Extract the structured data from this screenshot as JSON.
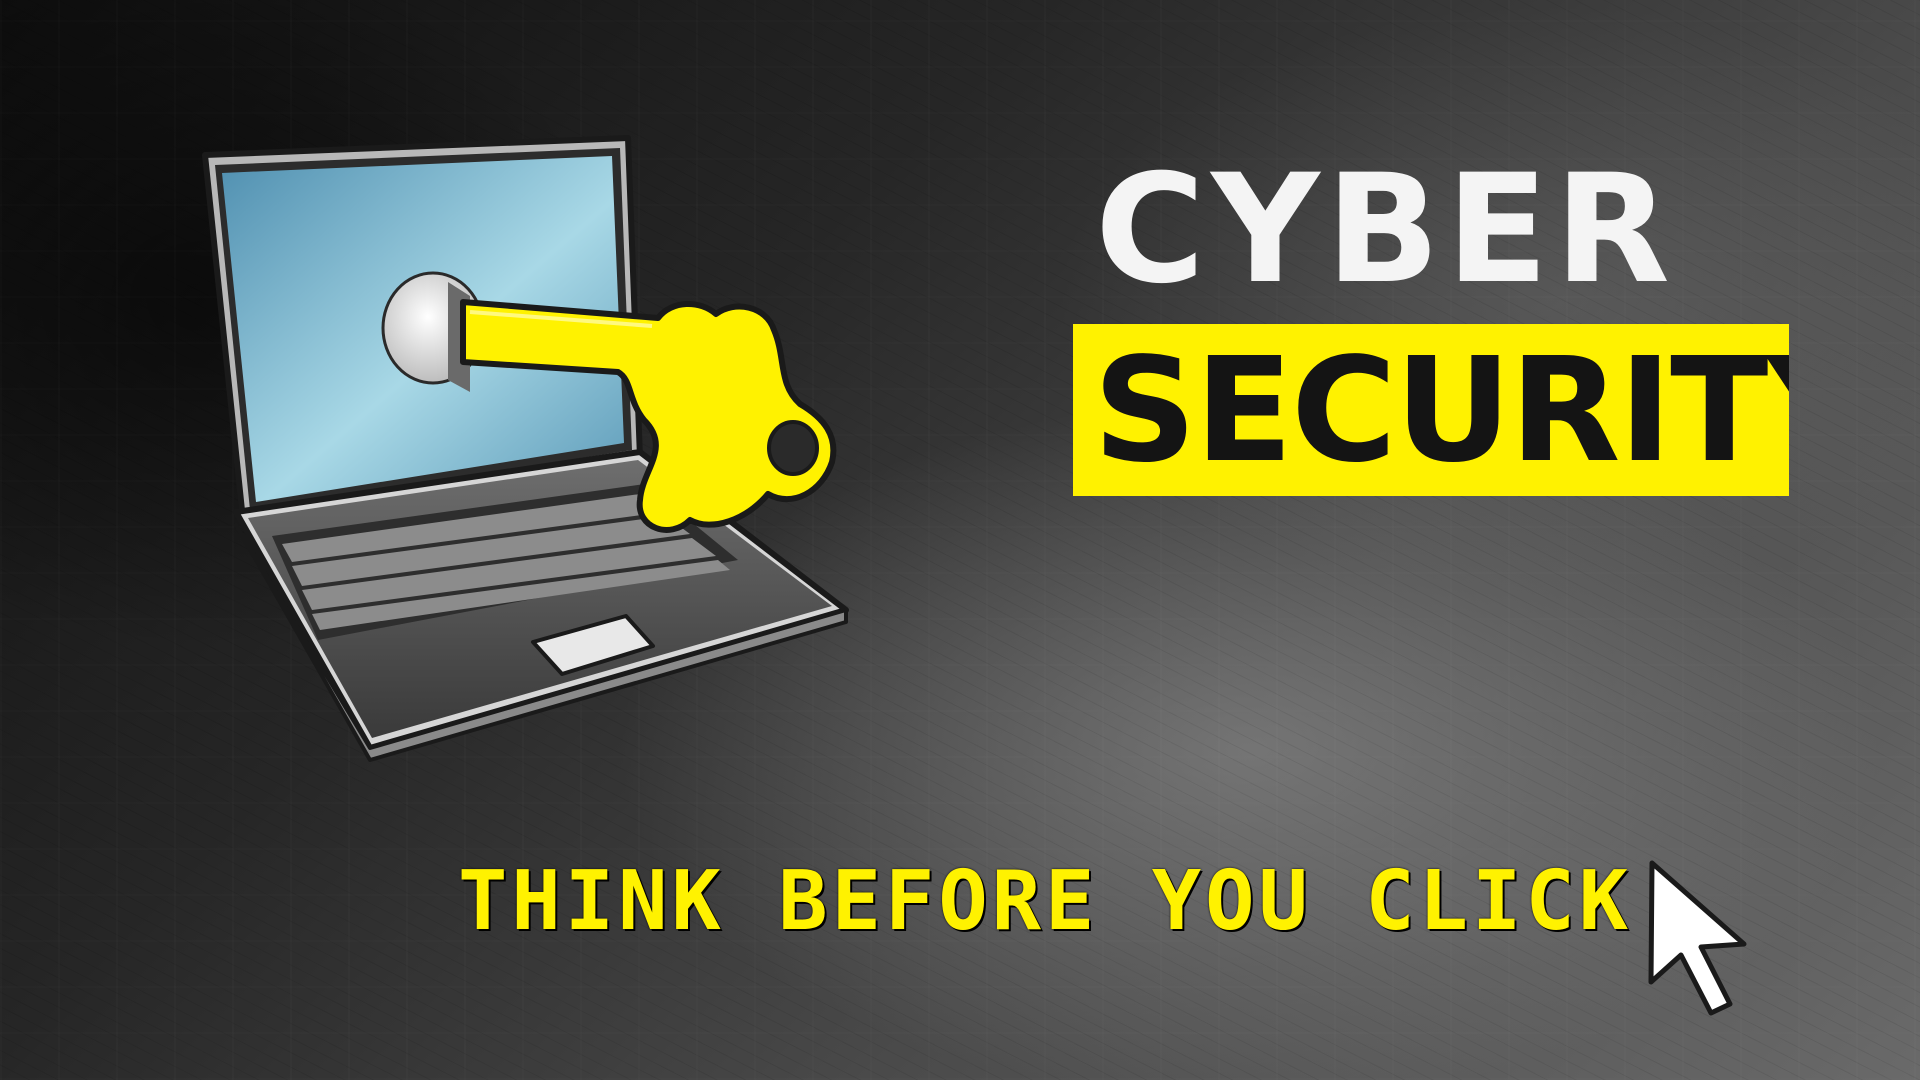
{
  "poster": {
    "title_line1": "CYBER",
    "title_line2": "SECURITY",
    "tagline": "THINK BEFORE YOU CLICK"
  },
  "colors": {
    "accent_yellow": "#fff200",
    "title_white": "#f4f4f4",
    "dark_text": "#141414",
    "screen_blue": "#6fa8c4",
    "laptop_gray": "#505050"
  },
  "icons": {
    "laptop": "laptop-icon",
    "key": "key-icon",
    "keyhole": "keyhole-icon",
    "cursor": "mouse-pointer-icon"
  }
}
